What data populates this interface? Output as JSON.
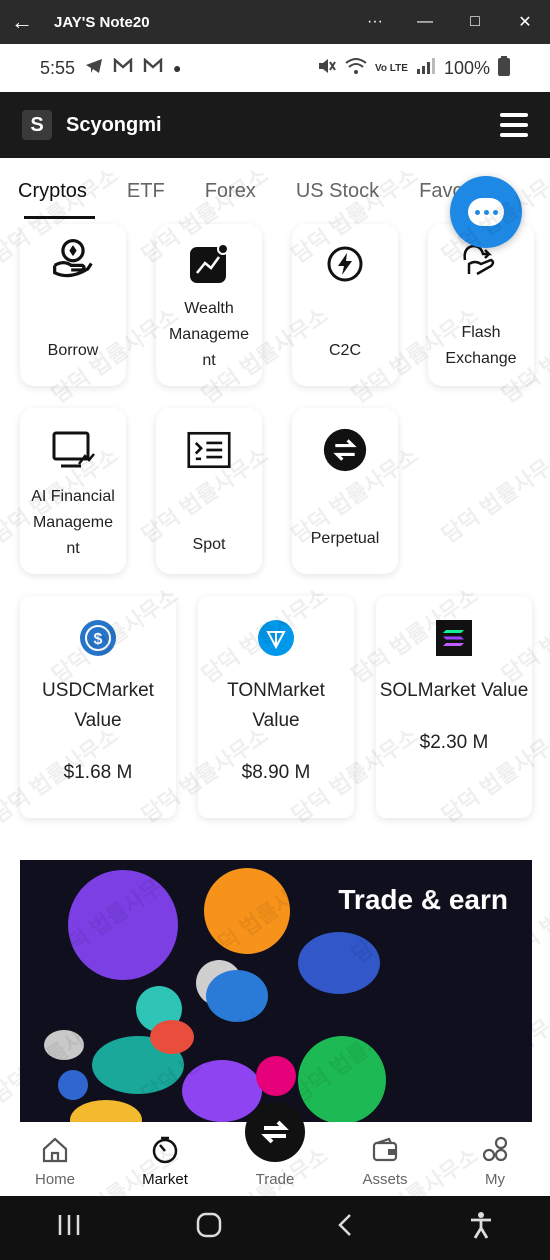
{
  "window": {
    "title": "JAY'S Note20",
    "back_icon": "arrow-left-icon",
    "more_label": "···",
    "minimize_label": "—",
    "maximize_label": "□",
    "close_label": "✕"
  },
  "status": {
    "time": "5:55",
    "battery": "100%",
    "lte": "Vo LTE"
  },
  "app": {
    "name": "Scyongmi",
    "logo_letter": "S"
  },
  "tabs": [
    "Cryptos",
    "ETF",
    "Forex",
    "US Stock",
    "Favorites"
  ],
  "features": [
    {
      "label": "Borrow",
      "icon": "hand-coin-icon"
    },
    {
      "label": "Wealth Manageme nt",
      "icon": "chart-notification-icon"
    },
    {
      "label": "C2C",
      "icon": "lightning-circle-icon"
    },
    {
      "label": "Flash Exchange",
      "icon": "hand-swap-icon"
    },
    {
      "label": "AI Financial Manageme nt",
      "icon": "monitor-chart-icon"
    },
    {
      "label": "Spot",
      "icon": "terminal-list-icon"
    },
    {
      "label": "Perpetual",
      "icon": "swap-circle-icon"
    }
  ],
  "markets": [
    {
      "name": "USDCMarket Value",
      "value": "$1.68 M",
      "color": "#2775ca"
    },
    {
      "name": "TONMarket Value",
      "value": "$8.90 M",
      "color": "#0098ea"
    },
    {
      "name": "SOLMarket Value",
      "value": "$2.30 M",
      "color": "#14f195"
    }
  ],
  "banner": {
    "text": "Trade & earn"
  },
  "nav": {
    "home": "Home",
    "market": "Market",
    "trade": "Trade",
    "assets": "Assets",
    "my": "My"
  },
  "watermark": "담덕 법률사무소"
}
